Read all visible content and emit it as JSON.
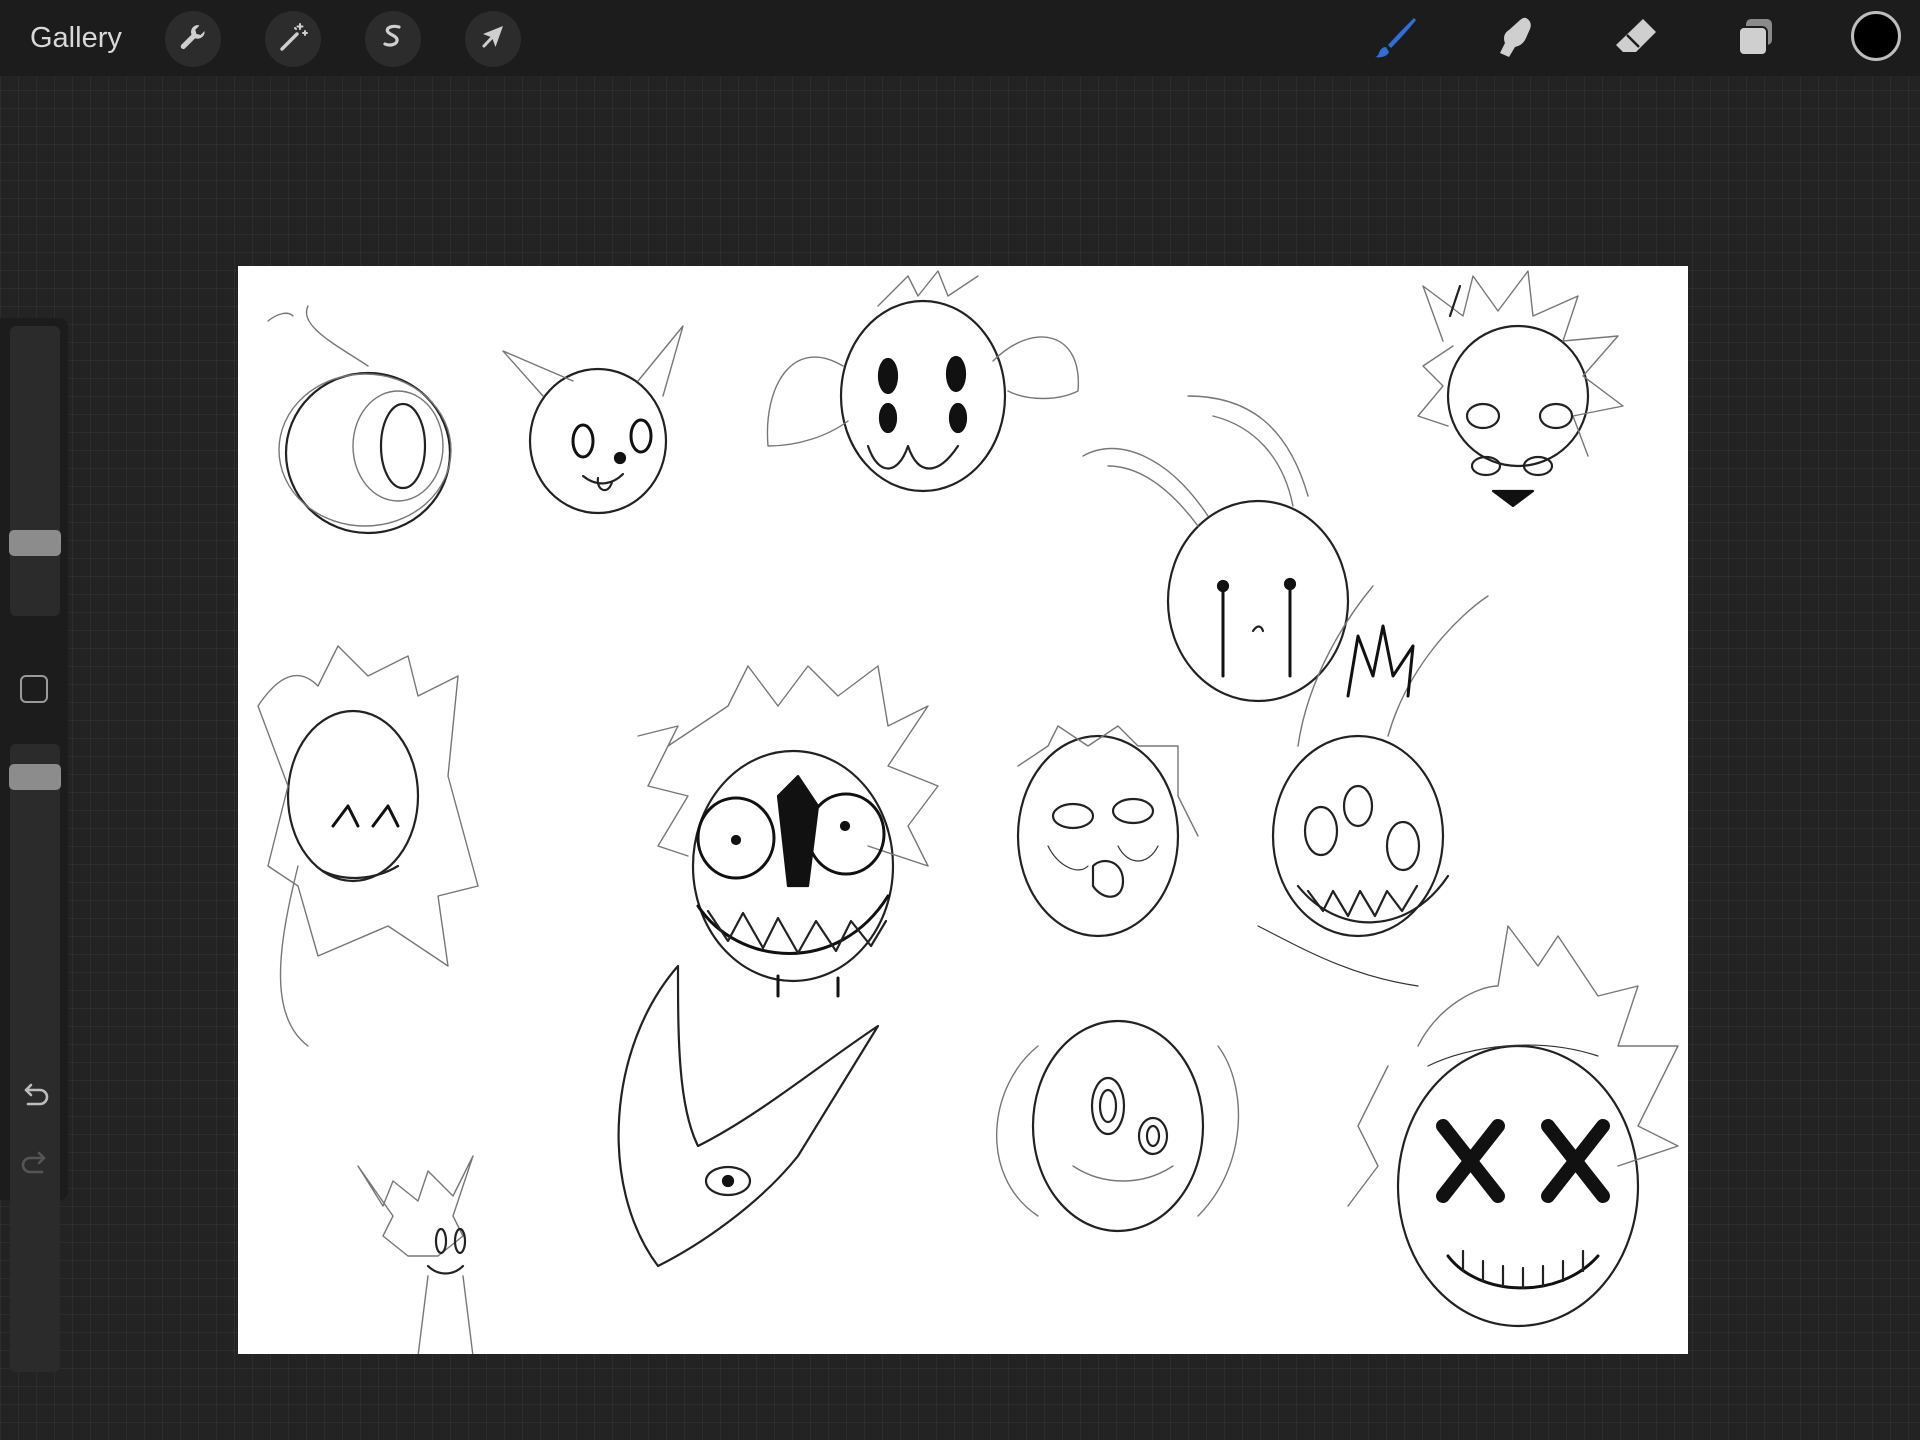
{
  "app": {
    "gallery_label": "Gallery"
  },
  "toolbar": {
    "left_tools": [
      {
        "name": "actions",
        "icon": "wrench-icon"
      },
      {
        "name": "adjustments",
        "icon": "magic-wand-icon"
      },
      {
        "name": "selection",
        "icon": "selection-s-icon"
      },
      {
        "name": "transform",
        "icon": "arrow-cursor-icon"
      }
    ],
    "right_tools": [
      {
        "name": "brush",
        "icon": "brush-icon",
        "active": true
      },
      {
        "name": "smudge",
        "icon": "smudge-finger-icon",
        "active": false
      },
      {
        "name": "eraser",
        "icon": "eraser-icon",
        "active": false
      },
      {
        "name": "layers",
        "icon": "layers-icon",
        "active": false
      }
    ],
    "current_color": "#000000",
    "active_color": "#2f6fd6"
  },
  "sidebar": {
    "brush_size_level": 0.7,
    "opacity_level": 0.98,
    "modify_icon": "square-modify-icon",
    "undo_icon": "undo-arrow-icon",
    "redo_icon": "redo-arrow-icon"
  },
  "canvas": {
    "background": "#ffffff",
    "content": "sketch-drawing"
  }
}
